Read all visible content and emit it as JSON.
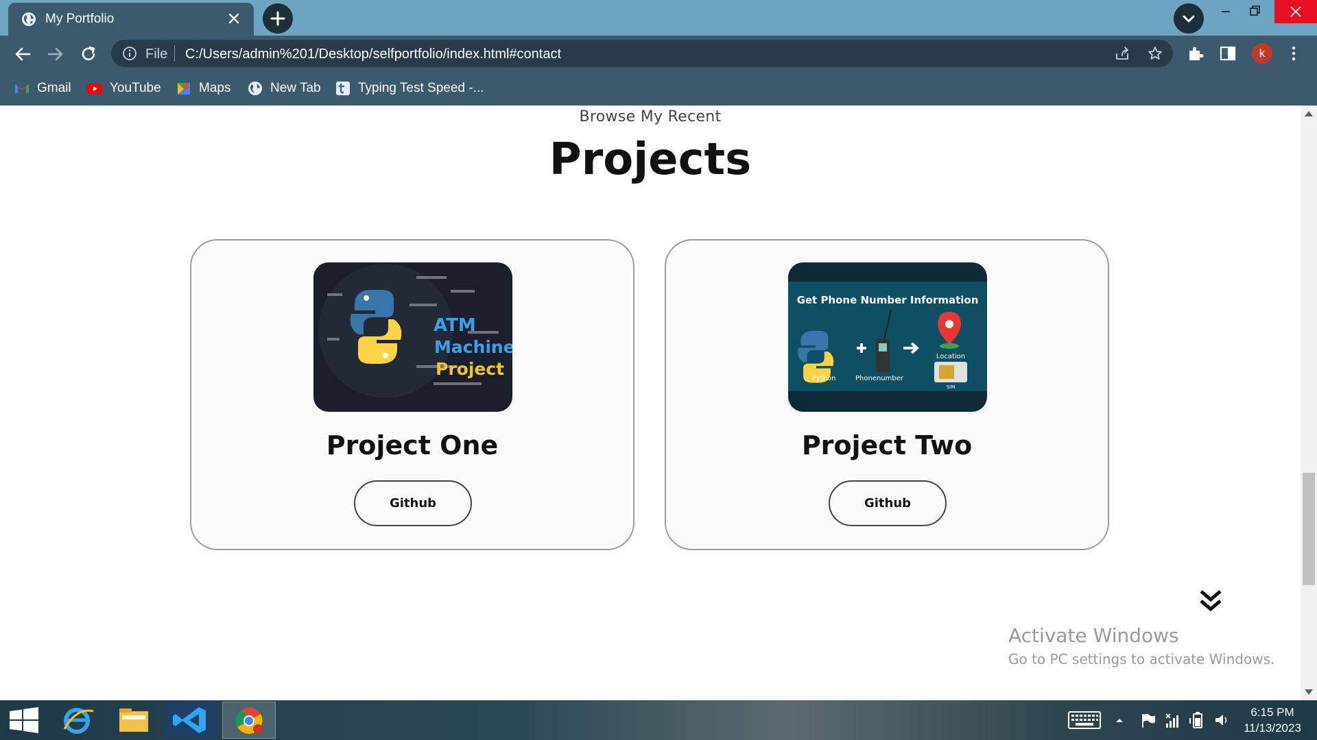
{
  "browser": {
    "tab_title": "My Portfolio",
    "address": {
      "scheme_label": "File",
      "url": "C:/Users/admin%201/Desktop/selfportfolio/index.html#contact"
    },
    "profile_initial": "k",
    "bookmarks": [
      {
        "label": "Gmail",
        "icon": "gmail-icon"
      },
      {
        "label": "YouTube",
        "icon": "youtube-icon"
      },
      {
        "label": "Maps",
        "icon": "maps-icon"
      },
      {
        "label": "New Tab",
        "icon": "globe-icon"
      },
      {
        "label": "Typing Test Speed -...",
        "icon": "typing-test-icon"
      }
    ]
  },
  "page": {
    "subtitle": "Browse My Recent",
    "heading": "Projects",
    "projects": [
      {
        "title": "Project One",
        "button": "Github",
        "thumb_text": [
          "ATM",
          "Machine",
          "Project"
        ]
      },
      {
        "title": "Project Two",
        "button": "Github",
        "thumb_text": {
          "header": "Get Phone Number Information",
          "python": "Python",
          "phone": "Phonenumber",
          "location": "Location",
          "sim": "SIM"
        }
      }
    ]
  },
  "watermark": {
    "line1": "Activate Windows",
    "line2": "Go to PC settings to activate Windows."
  },
  "taskbar": {
    "time": "6:15 PM",
    "date": "11/13/2023"
  },
  "colors": {
    "tabstrip": "#6da4c2",
    "toolbar": "#3c5a6e",
    "omnibox": "#283b48",
    "close_red": "#e81123"
  }
}
